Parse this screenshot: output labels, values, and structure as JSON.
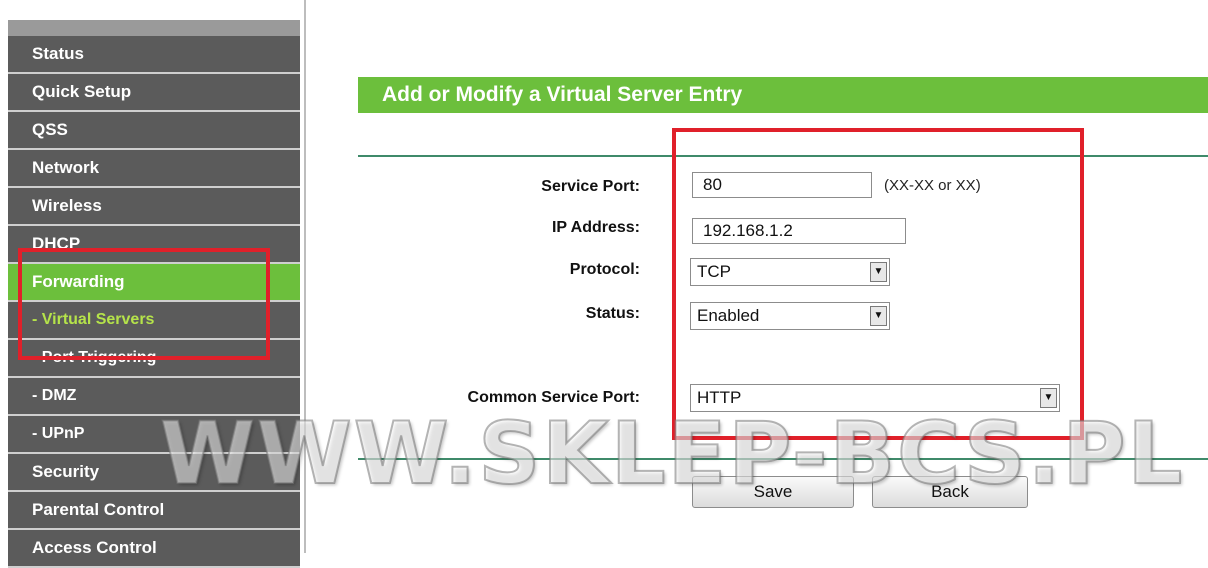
{
  "sidebar": {
    "items": [
      {
        "label": "Status"
      },
      {
        "label": "Quick Setup"
      },
      {
        "label": "QSS"
      },
      {
        "label": "Network"
      },
      {
        "label": "Wireless"
      },
      {
        "label": "DHCP"
      },
      {
        "label": "Forwarding"
      },
      {
        "label": "- Virtual Servers"
      },
      {
        "label": "- Port Triggering"
      },
      {
        "label": "- DMZ"
      },
      {
        "label": "- UPnP"
      },
      {
        "label": "Security"
      },
      {
        "label": "Parental Control"
      },
      {
        "label": "Access Control"
      }
    ]
  },
  "main": {
    "title": "Add or Modify a Virtual Server Entry",
    "service_port": {
      "label": "Service Port:",
      "value": "80",
      "hint": "(XX-XX or XX)"
    },
    "ip_address": {
      "label": "IP Address:",
      "value": "192.168.1.2"
    },
    "protocol": {
      "label": "Protocol:",
      "value": "TCP"
    },
    "status": {
      "label": "Status:",
      "value": "Enabled"
    },
    "common_service_port": {
      "label": "Common Service Port:",
      "value": "HTTP"
    },
    "buttons": {
      "save": "Save",
      "back": "Back"
    }
  },
  "watermark": "WWW.SKLEP-BCS.PL",
  "colors": {
    "accent_green": "#6cbf3c",
    "sidebar_gray": "#5b5b5b",
    "highlight_red": "#e0202a",
    "submenu_active": "#b5e34a"
  }
}
